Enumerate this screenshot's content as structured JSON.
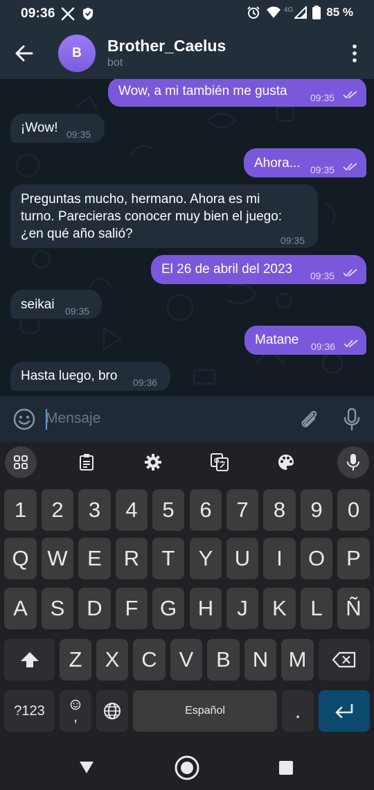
{
  "status_bar": {
    "time": "09:36",
    "network": "4G",
    "battery": "85 %",
    "icons": [
      "x-icon",
      "shield-icon",
      "alarm-icon",
      "wifi-icon",
      "signal-icon",
      "battery-icon"
    ]
  },
  "header": {
    "title": "Brother_Caelus",
    "subtitle": "bot",
    "avatar_letter": "B",
    "avatar_color": "#8a6bec"
  },
  "messages": [
    {
      "direction": "out",
      "text": "Wow, a mi también me gusta",
      "time": "09:35",
      "read": true
    },
    {
      "direction": "in",
      "text": "¡Wow!",
      "time": "09:35"
    },
    {
      "direction": "out",
      "text": "Ahora...",
      "time": "09:35",
      "read": true
    },
    {
      "direction": "in",
      "lines": [
        "Preguntas mucho, hermano. Ahora es mi",
        "turno. Parecieras conocer muy bien el juego:",
        "¿en qué año salió?"
      ],
      "time": "09:35"
    },
    {
      "direction": "out",
      "text": "El 26 de abril del 2023",
      "time": "09:35",
      "read": true
    },
    {
      "direction": "in",
      "text": "seikai",
      "time": "09:35"
    },
    {
      "direction": "out",
      "text": "Matane",
      "time": "09:36",
      "read": true
    },
    {
      "direction": "in",
      "text": "Hasta luego, bro",
      "time": "09:36"
    }
  ],
  "input": {
    "placeholder": "Mensaje"
  },
  "keyboard": {
    "rows": [
      [
        "1",
        "2",
        "3",
        "4",
        "5",
        "6",
        "7",
        "8",
        "9",
        "0"
      ],
      [
        "Q",
        "W",
        "E",
        "R",
        "T",
        "Y",
        "U",
        "I",
        "O",
        "P"
      ],
      [
        "A",
        "S",
        "D",
        "F",
        "G",
        "H",
        "J",
        "K",
        "L",
        "Ñ"
      ],
      [
        "Z",
        "X",
        "C",
        "V",
        "B",
        "N",
        "M"
      ]
    ],
    "symbols_label": "?123",
    "comma_label": ",",
    "space_label": "Español",
    "period_label": "."
  },
  "colors": {
    "outgoing_bubble": "#7a58dc",
    "incoming_bubble": "#222d39",
    "chat_background": "#131b23",
    "enter_key": "#0b4a6e"
  }
}
